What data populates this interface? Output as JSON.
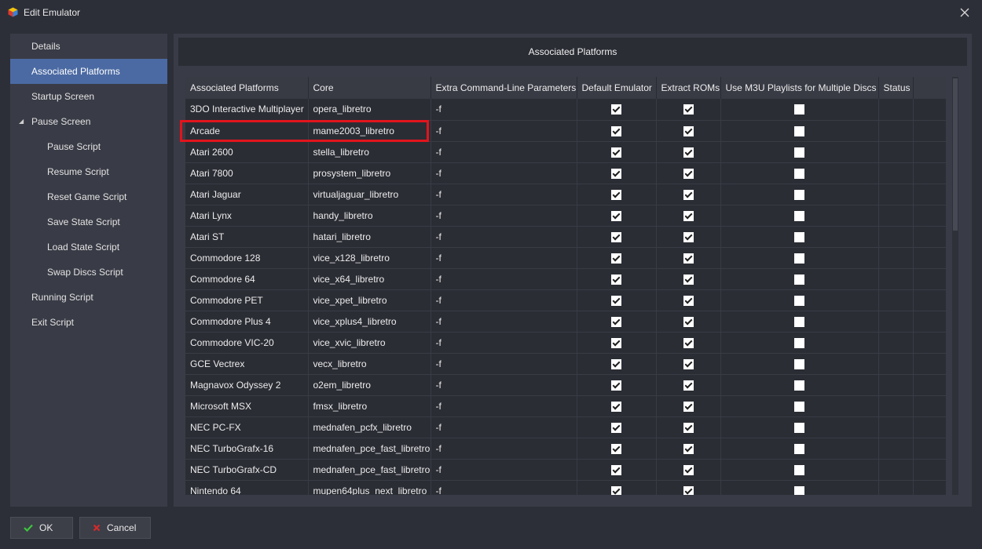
{
  "window": {
    "title": "Edit Emulator"
  },
  "sidebar": {
    "items": [
      {
        "label": "Details"
      },
      {
        "label": "Associated Platforms"
      },
      {
        "label": "Startup Screen"
      },
      {
        "label": "Pause Screen"
      },
      {
        "label": "Pause Script"
      },
      {
        "label": "Resume Script"
      },
      {
        "label": "Reset Game Script"
      },
      {
        "label": "Save State Script"
      },
      {
        "label": "Load State Script"
      },
      {
        "label": "Swap Discs Script"
      },
      {
        "label": "Running Script"
      },
      {
        "label": "Exit Script"
      }
    ]
  },
  "main": {
    "header": "Associated Platforms",
    "columns": [
      "Associated Platforms",
      "Core",
      "Extra Command-Line Parameters",
      "Default Emulator",
      "Extract ROMs",
      "Use M3U Playlists for Multiple Discs",
      "Status"
    ],
    "rows": [
      {
        "platform": "3DO Interactive Multiplayer",
        "core": "opera_libretro",
        "params": "-f",
        "default": true,
        "extract": true,
        "m3u": false,
        "status": ""
      },
      {
        "platform": "Arcade",
        "core": "mame2003_libretro",
        "params": "-f",
        "default": true,
        "extract": true,
        "m3u": false,
        "status": ""
      },
      {
        "platform": "Atari 2600",
        "core": "stella_libretro",
        "params": "-f",
        "default": true,
        "extract": true,
        "m3u": false,
        "status": ""
      },
      {
        "platform": "Atari 7800",
        "core": "prosystem_libretro",
        "params": "-f",
        "default": true,
        "extract": true,
        "m3u": false,
        "status": ""
      },
      {
        "platform": "Atari Jaguar",
        "core": "virtualjaguar_libretro",
        "params": "-f",
        "default": true,
        "extract": true,
        "m3u": false,
        "status": ""
      },
      {
        "platform": "Atari Lynx",
        "core": "handy_libretro",
        "params": "-f",
        "default": true,
        "extract": true,
        "m3u": false,
        "status": ""
      },
      {
        "platform": "Atari ST",
        "core": "hatari_libretro",
        "params": "-f",
        "default": true,
        "extract": true,
        "m3u": false,
        "status": ""
      },
      {
        "platform": "Commodore 128",
        "core": "vice_x128_libretro",
        "params": "-f",
        "default": true,
        "extract": true,
        "m3u": false,
        "status": ""
      },
      {
        "platform": "Commodore 64",
        "core": "vice_x64_libretro",
        "params": "-f",
        "default": true,
        "extract": true,
        "m3u": false,
        "status": ""
      },
      {
        "platform": "Commodore PET",
        "core": "vice_xpet_libretro",
        "params": "-f",
        "default": true,
        "extract": true,
        "m3u": false,
        "status": ""
      },
      {
        "platform": "Commodore Plus 4",
        "core": "vice_xplus4_libretro",
        "params": "-f",
        "default": true,
        "extract": true,
        "m3u": false,
        "status": ""
      },
      {
        "platform": "Commodore VIC-20",
        "core": "vice_xvic_libretro",
        "params": "-f",
        "default": true,
        "extract": true,
        "m3u": false,
        "status": ""
      },
      {
        "platform": "GCE Vectrex",
        "core": "vecx_libretro",
        "params": "-f",
        "default": true,
        "extract": true,
        "m3u": false,
        "status": ""
      },
      {
        "platform": "Magnavox Odyssey 2",
        "core": "o2em_libretro",
        "params": "-f",
        "default": true,
        "extract": true,
        "m3u": false,
        "status": ""
      },
      {
        "platform": "Microsoft MSX",
        "core": "fmsx_libretro",
        "params": "-f",
        "default": true,
        "extract": true,
        "m3u": false,
        "status": ""
      },
      {
        "platform": "NEC PC-FX",
        "core": "mednafen_pcfx_libretro",
        "params": "-f",
        "default": true,
        "extract": true,
        "m3u": false,
        "status": ""
      },
      {
        "platform": "NEC TurboGrafx-16",
        "core": "mednafen_pce_fast_libretro",
        "params": "-f",
        "default": true,
        "extract": true,
        "m3u": false,
        "status": ""
      },
      {
        "platform": "NEC TurboGrafx-CD",
        "core": "mednafen_pce_fast_libretro",
        "params": "-f",
        "default": true,
        "extract": true,
        "m3u": false,
        "status": ""
      },
      {
        "platform": "Nintendo 64",
        "core": "mupen64plus_next_libretro",
        "params": "-f",
        "default": true,
        "extract": true,
        "m3u": false,
        "status": ""
      }
    ]
  },
  "footer": {
    "ok_label": "OK",
    "cancel_label": "Cancel"
  },
  "colors": {
    "accent": "#4b6aa3",
    "highlight": "#e2141c",
    "ok_icon": "#3cc63c",
    "cancel_icon": "#d42a2a"
  },
  "icons": {
    "app": "app-cube-icon",
    "close": "close-icon",
    "ok": "checkmark-icon",
    "cancel": "cancel-x-icon",
    "caret": "caret-expanded-icon"
  }
}
